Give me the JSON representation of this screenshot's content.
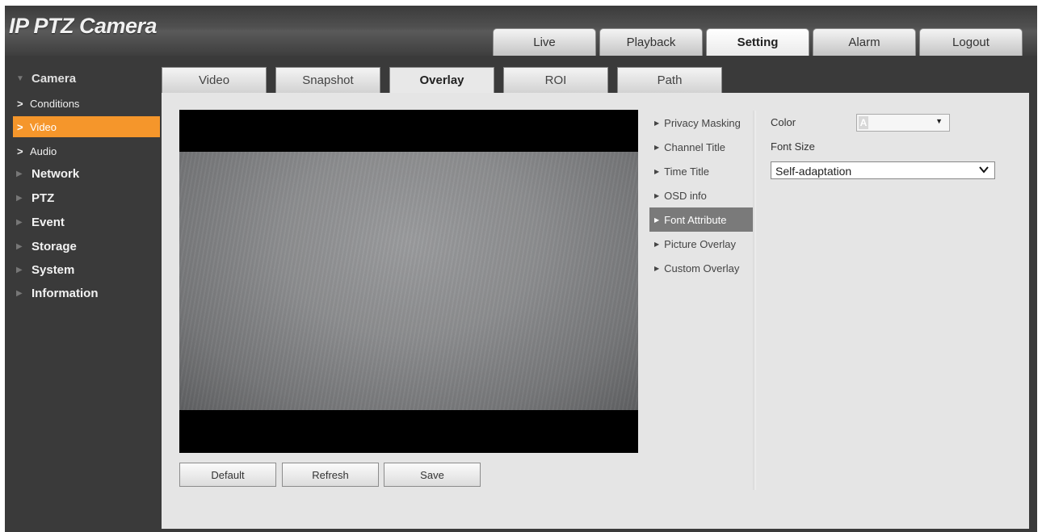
{
  "app": {
    "title": "IP PTZ Camera"
  },
  "topnav": [
    "Live",
    "Playback",
    "Setting",
    "Alarm",
    "Logout"
  ],
  "topnav_active": "Setting",
  "sidebar": {
    "camera": "Camera",
    "camera_items": [
      "Conditions",
      "Video",
      "Audio"
    ],
    "active_item": "Video",
    "groups": [
      "Network",
      "PTZ",
      "Event",
      "Storage",
      "System",
      "Information"
    ]
  },
  "subtabs": [
    "Video",
    "Snapshot",
    "Overlay",
    "ROI",
    "Path"
  ],
  "subtab_active": "Overlay",
  "overlay_menu": [
    "Privacy Masking",
    "Channel Title",
    "Time Title",
    "OSD info",
    "Font Attribute",
    "Picture Overlay",
    "Custom Overlay"
  ],
  "overlay_menu_active": "Font Attribute",
  "font_attribute": {
    "color_label": "Color",
    "color_swatch_text": "A",
    "font_size_label": "Font Size",
    "font_size_value": "Self-adaptation"
  },
  "buttons": {
    "default": "Default",
    "refresh": "Refresh",
    "save": "Save"
  },
  "colors": {
    "accent": "#f5962b",
    "header_bg": "#4a4a4a",
    "panel_bg": "#e5e5e5"
  },
  "icons": [
    "triangle-down-icon",
    "triangle-right-icon",
    "chevron-right-icon",
    "caret-down-icon"
  ]
}
